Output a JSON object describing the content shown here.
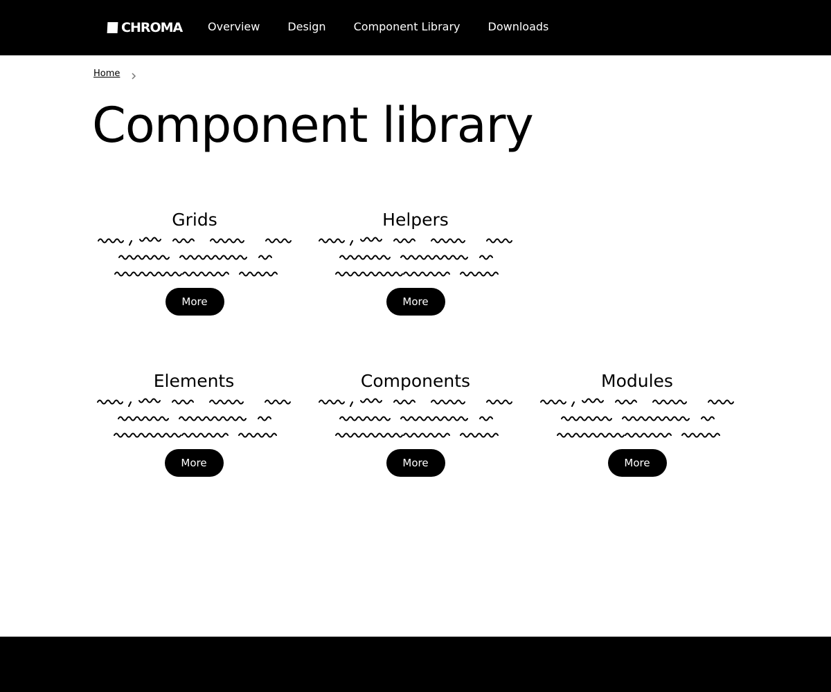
{
  "brand": {
    "name": "CHROMA",
    "icon": "logo-square-icon"
  },
  "nav": {
    "items": [
      {
        "label": "Overview"
      },
      {
        "label": "Design"
      },
      {
        "label": "Component Library"
      },
      {
        "label": "Downloads"
      }
    ]
  },
  "breadcrumb": {
    "home_label": "Home",
    "separator_icon": "chevron-right-icon"
  },
  "page": {
    "title": "Component library"
  },
  "cards": [
    {
      "title": "Grids",
      "button_label": "More"
    },
    {
      "title": "Helpers",
      "button_label": "More"
    },
    {
      "title": "Elements",
      "button_label": "More"
    },
    {
      "title": "Components",
      "button_label": "More"
    },
    {
      "title": "Modules",
      "button_label": "More"
    }
  ],
  "colors": {
    "background": "#ffffff",
    "bars": "#000000",
    "text": "#000000",
    "button_text": "#ffffff"
  }
}
